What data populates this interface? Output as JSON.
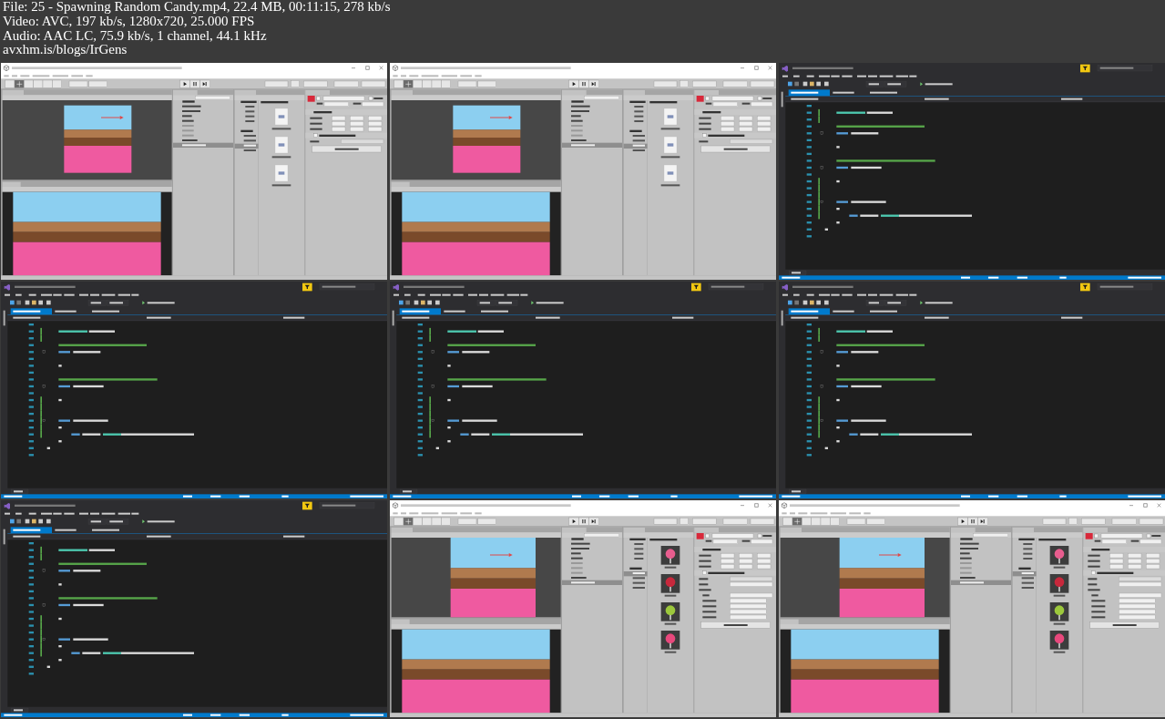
{
  "header": {
    "lines": [
      "File: 25 - Spawning Random Candy.mp4, 22.4 MB, 00:11:15, 278 kb/s",
      "Video: AVC, 197 kb/s, 1280x720, 25.000 FPS",
      "Audio: AAC LC, 75.9 kb/s, 1 channel, 44.1 kHz",
      "avxhm.is/blogs/IrGens"
    ]
  },
  "frames": [
    {
      "kind": "editor"
    },
    {
      "kind": "editor"
    },
    {
      "kind": "code"
    },
    {
      "kind": "code"
    },
    {
      "kind": "code"
    },
    {
      "kind": "code"
    },
    {
      "kind": "code"
    },
    {
      "kind": "prefabs"
    },
    {
      "kind": "prefabs"
    }
  ]
}
